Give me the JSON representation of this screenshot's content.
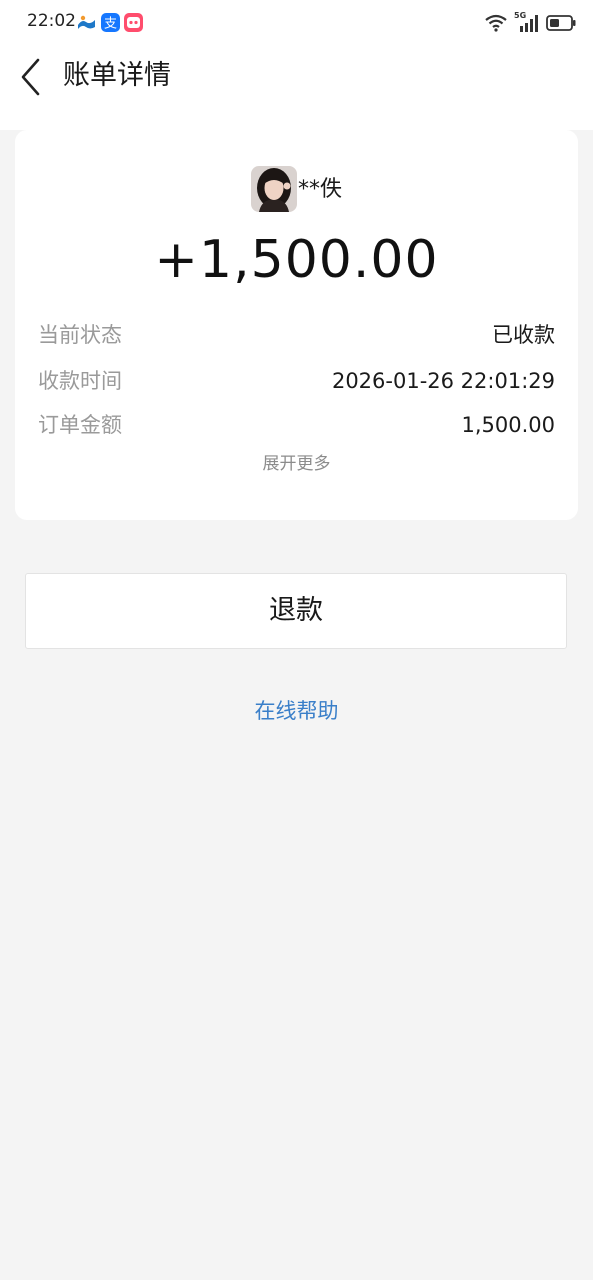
{
  "status_bar": {
    "time": "22:02",
    "network_label": "5G",
    "icons": [
      "app-notification-icon",
      "alipay-icon",
      "app-pink-icon",
      "wifi-icon",
      "signal-5g-icon",
      "battery-icon"
    ]
  },
  "nav": {
    "back_icon": "chevron-left-icon",
    "title": "账单详情"
  },
  "payer": {
    "name": "**佚"
  },
  "amount": "+1,500.00",
  "details": [
    {
      "label": "当前状态",
      "value": "已收款"
    },
    {
      "label": "收款时间",
      "value": "2026-01-26 22:01:29"
    },
    {
      "label": "订单金额",
      "value": "1,500.00"
    }
  ],
  "expand_label": "展开更多",
  "refund_label": "退款",
  "help_label": "在线帮助",
  "colors": {
    "background": "#f4f4f4",
    "card": "#ffffff",
    "link": "#3a7fc9",
    "label": "#9a9a9a"
  }
}
